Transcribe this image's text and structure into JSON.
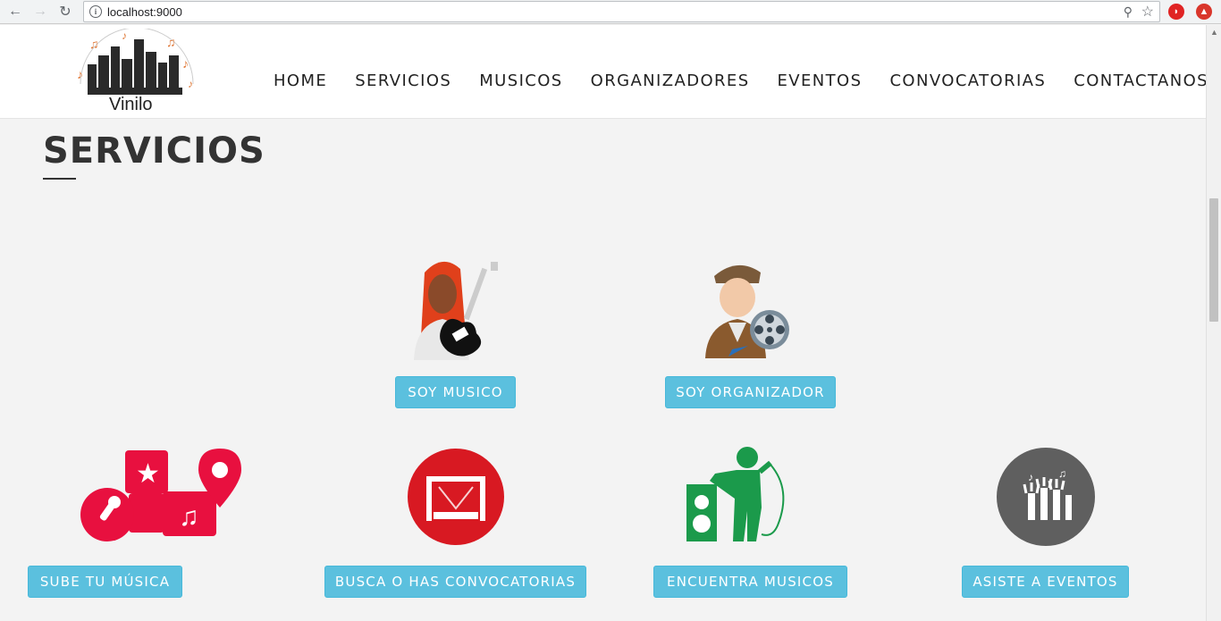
{
  "browser": {
    "url": "localhost:9000",
    "back_icon": "←",
    "forward_icon": "→",
    "reload_icon": "↻",
    "zoom_icon": "⚲",
    "star_icon": "☆"
  },
  "site": {
    "logo_text": "Vinilo",
    "menu": [
      "HOME",
      "SERVICIOS",
      "MUSICOS",
      "ORGANIZADORES",
      "EVENTOS",
      "CONVOCATORIAS",
      "CONTACTANOS"
    ]
  },
  "section": {
    "title": "SERVICIOS"
  },
  "roles": [
    {
      "label": "SOY MUSICO",
      "icon": "musician-guitar-icon"
    },
    {
      "label": "SOY ORGANIZADOR",
      "icon": "organizer-film-icon"
    }
  ],
  "services": [
    {
      "label": "SUBE TU MÚSICA",
      "icon": "music-puzzle-icon"
    },
    {
      "label": "BUSCA O HAS CONVOCATORIAS",
      "icon": "stage-icon"
    },
    {
      "label": "ENCUENTRA MUSICOS",
      "icon": "singer-icon"
    },
    {
      "label": "ASISTE A EVENTOS",
      "icon": "concert-crowd-icon"
    }
  ],
  "colors": {
    "button": "#5bc0de",
    "accent_red": "#e8103f",
    "green": "#1b9a4b"
  }
}
